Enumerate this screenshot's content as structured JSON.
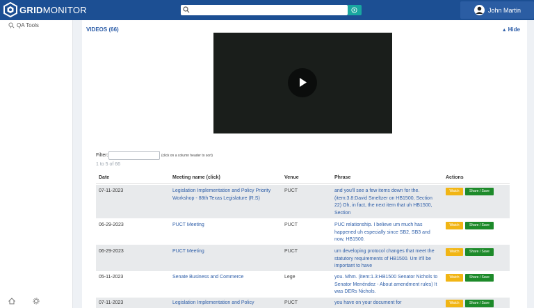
{
  "app": {
    "brand_bold": "GRID",
    "brand_light": "MONITOR",
    "accent": "#1c4f93"
  },
  "search": {
    "placeholder": "",
    "value": ""
  },
  "user": {
    "name": "John Martin"
  },
  "sidebar": {
    "items": [
      {
        "label": "QA Tools",
        "icon": "qa-tools-icon"
      }
    ]
  },
  "videos": {
    "title": "VIDEOS (66)",
    "hide_label": "Hide",
    "filter_label": "Filter:",
    "filter_value": "",
    "filter_hint": "(click on a column header to sort)",
    "count_text": "1 to 5 of 66",
    "columns": [
      "Date",
      "Meeting name (click)",
      "Venue",
      "Phrase",
      "Actions"
    ],
    "watch_label": "Watch",
    "share_label": "Share / Save",
    "rows": [
      {
        "date": "07-11-2023",
        "meeting": "Legislation Implementation and Policy Priority Workshop - 88th Texas Legislature (R.S)",
        "venue": "PUCT",
        "phrase": "and you'll see a few items down for the. (item:3.8:David Smeltzer on HB1500, Section 22) Oh, in fact, the next item that uh HB1500, Section"
      },
      {
        "date": "06-29-2023",
        "meeting": "PUCT Meeting",
        "venue": "PUCT",
        "phrase": "PUC relationship. I believe um much has happened uh especially since SB2, SB3 and now, HB1500."
      },
      {
        "date": "06-29-2023",
        "meeting": "PUCT Meeting",
        "venue": "PUCT",
        "phrase": "um developing protocol changes that meet the statutory requirements of HB1500. Um it'll be important to have"
      },
      {
        "date": "05-11-2023",
        "meeting": "Senate Business and Commerce",
        "venue": "Lege",
        "phrase": "you. Mhm. (item:1.3:HB1500 Senator Nichols to Senator Menéndez - About amendment rules) It was DERs Nichols."
      },
      {
        "date": "07-11-2023",
        "meeting": "Legislation Implementation and Policy",
        "venue": "PUCT",
        "phrase": "you have on your document for"
      }
    ]
  }
}
